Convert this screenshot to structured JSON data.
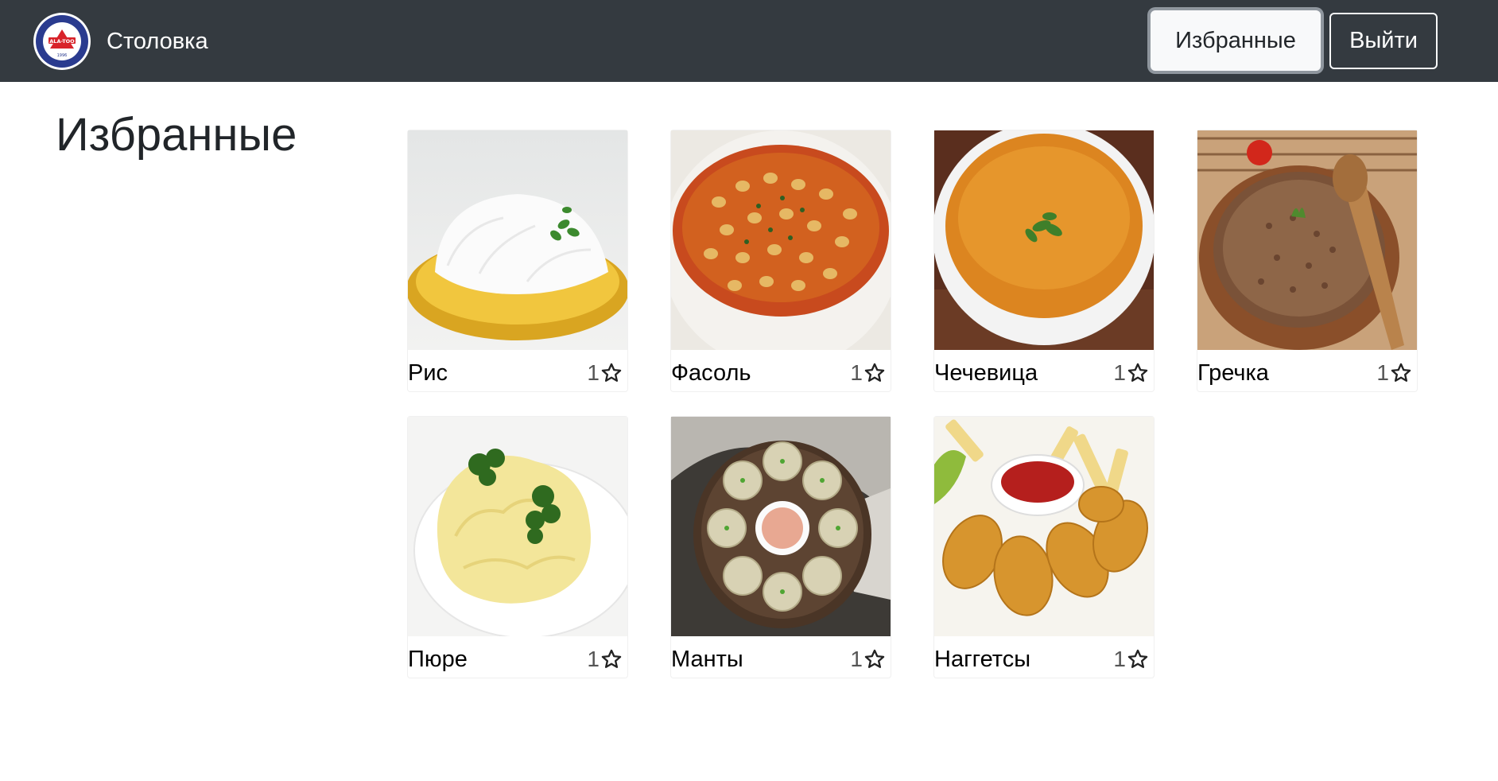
{
  "navbar": {
    "brand": "Столовка",
    "logo_text": "ALA-TOO",
    "logo_year": "1996",
    "favorites_button": "Избранные",
    "logout_button": "Выйти"
  },
  "page": {
    "title": "Избранные"
  },
  "icons": {
    "favorite": "star-outline-icon",
    "logo": "university-logo-icon"
  },
  "dishes": [
    {
      "name": "Рис",
      "likes": "1",
      "image": "rice-dish"
    },
    {
      "name": "Фасоль",
      "likes": "1",
      "image": "bean-soup-dish"
    },
    {
      "name": "Чечевица",
      "likes": "1",
      "image": "lentil-soup-dish"
    },
    {
      "name": "Гречка",
      "likes": "1",
      "image": "buckwheat-dish"
    },
    {
      "name": "Пюре",
      "likes": "1",
      "image": "mashed-potato-dish"
    },
    {
      "name": "Манты",
      "likes": "1",
      "image": "manti-dish"
    },
    {
      "name": "Наггетсы",
      "likes": "1",
      "image": "nuggets-dish"
    }
  ],
  "colors": {
    "navbar": "#343a40",
    "text": "#212529",
    "button_light": "#f8f9fa"
  }
}
